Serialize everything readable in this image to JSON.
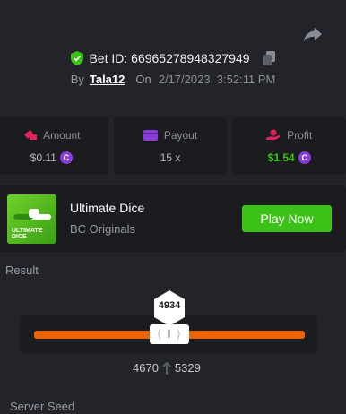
{
  "bet": {
    "id_text": "Bet ID: 66965278948327949",
    "by_label": "By",
    "user": "Tala12",
    "on_label": "On",
    "date": "2/17/2023, 3:52:11 PM"
  },
  "stats": {
    "amount": {
      "label": "Amount",
      "value": "$0.11",
      "icon": "money-bag-icon"
    },
    "payout": {
      "label": "Payout",
      "value": "15 x",
      "icon": "wallet-icon"
    },
    "profit": {
      "label": "Profit",
      "value": "$1.54",
      "icon": "hand-coin-icon"
    }
  },
  "game": {
    "title": "Ultimate Dice",
    "subtitle": "BC Originals",
    "play_label": "Play Now",
    "thumb_text": "ULTIMATE DICE"
  },
  "result": {
    "label": "Result",
    "roll": "4934",
    "range_low": "4670",
    "range_high": "5329",
    "handle_glyph": "⟨ ǁ ⟩"
  },
  "server_seed": {
    "label": "Server Seed"
  },
  "colors": {
    "accent_green": "#3bc117",
    "track_orange": "#ed6300",
    "amount_icon": "#e0245e",
    "payout_icon": "#8a3bd9",
    "profit_icon": "#e0245e",
    "coin": "#8a3bd9"
  }
}
